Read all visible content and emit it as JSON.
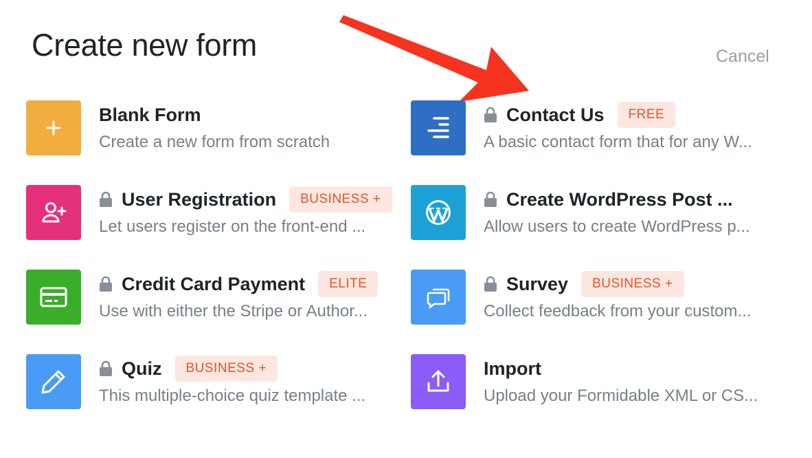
{
  "dialog": {
    "title": "Create new form",
    "cancel_label": "Cancel"
  },
  "templates": [
    {
      "name": "Blank Form",
      "description": "Create a new form from scratch",
      "locked": false,
      "badge": "",
      "icon": "plus-icon",
      "color": "#f2ad3f"
    },
    {
      "name": "Contact Us",
      "description": "A basic contact form that for any W...",
      "locked": true,
      "badge": "FREE",
      "icon": "align-lines-icon",
      "color": "#2e6fc4"
    },
    {
      "name": "User Registration",
      "description": "Let users register on the front-end ...",
      "locked": true,
      "badge": "BUSINESS +",
      "icon": "user-plus-icon",
      "color": "#e4307a"
    },
    {
      "name": "Create WordPress Post ...",
      "description": "Allow users to create WordPress p...",
      "locked": true,
      "badge": "",
      "icon": "wordpress-icon",
      "color": "#1da1d6"
    },
    {
      "name": "Credit Card Payment",
      "description": "Use with either the Stripe or Author...",
      "locked": true,
      "badge": "ELITE",
      "icon": "credit-card-icon",
      "color": "#3aae2a"
    },
    {
      "name": "Survey",
      "description": "Collect feedback from your custom...",
      "locked": true,
      "badge": "BUSINESS +",
      "icon": "chat-bubbles-icon",
      "color": "#4a9bf5"
    },
    {
      "name": "Quiz",
      "description": "This multiple-choice quiz template ...",
      "locked": true,
      "badge": "BUSINESS +",
      "icon": "pencil-icon",
      "color": "#4a9bf5"
    },
    {
      "name": "Import",
      "description": "Upload your Formidable XML or CS...",
      "locked": false,
      "badge": "",
      "icon": "upload-icon",
      "color": "#8b5cf6"
    }
  ]
}
